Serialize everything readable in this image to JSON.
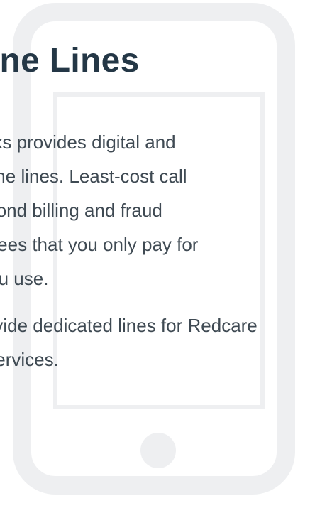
{
  "title": "Phone Lines",
  "paragraphs": [
    {
      "lines": [
        "Networks provides digital and",
        "telephone lines. Least-cost call",
        "per-second billing and fraud",
        "guarantees that you only pay for",
        "what you use."
      ]
    },
    {
      "lines": [
        "We provide dedicated lines for Redcare",
        "alarm services."
      ]
    }
  ],
  "colors": {
    "title": "#243746",
    "body_text": "#3f4a53",
    "phone_outline": "#eeeff1",
    "background": "#ffffff"
  },
  "icons": [
    "phone-illustration-icon",
    "home-button-icon"
  ]
}
